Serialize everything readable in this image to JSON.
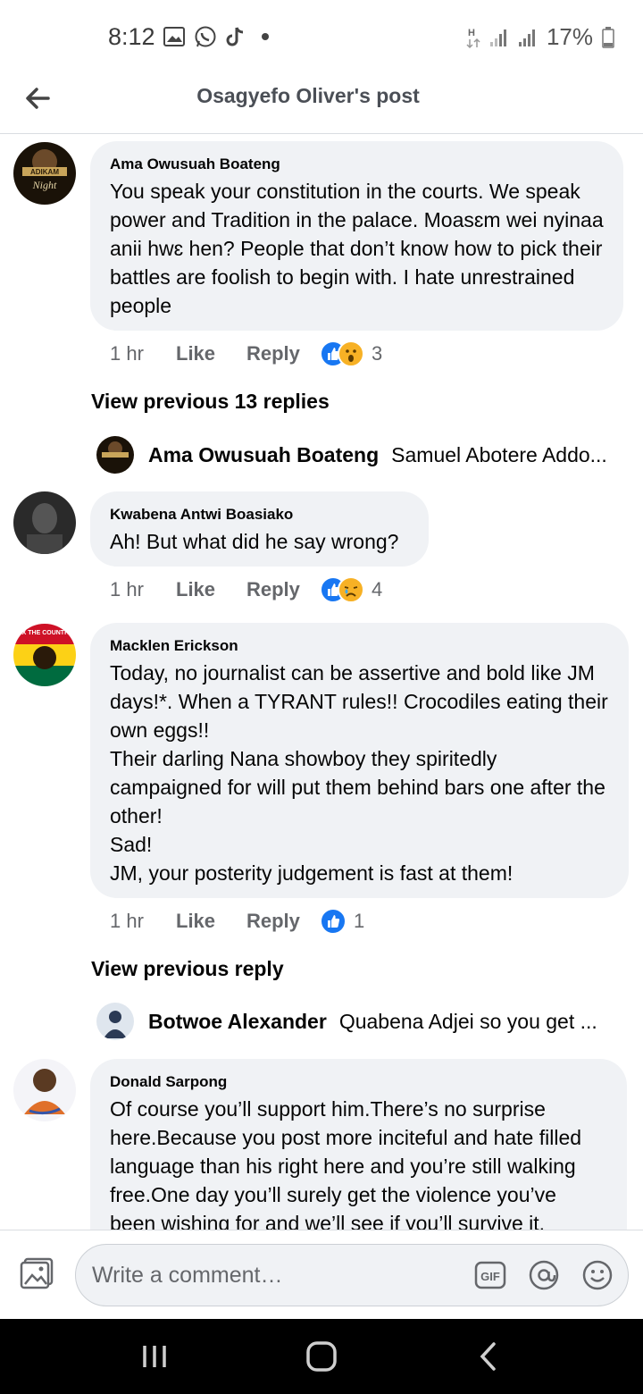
{
  "status_bar": {
    "time": "8:12",
    "battery": "17%",
    "network": "H"
  },
  "header": {
    "title": "Osagyefo Oliver's post"
  },
  "comments": [
    {
      "author": "Ama Owusuah Boateng",
      "text": "You speak your constitution in the courts. We speak power and Tradition in the palace. Moasɛm wei nyinaa anii hwɛ hen? People that don’t know how to pick their battles are foolish to begin with. I hate unrestrained people",
      "time": "1 hr",
      "like": "Like",
      "reply": "Reply",
      "reactions": [
        "like",
        "wow"
      ],
      "reaction_count": "3"
    },
    {
      "author": "Kwabena Antwi Boasiako",
      "text": "Ah! But what did he say wrong?",
      "time": "1 hr",
      "like": "Like",
      "reply": "Reply",
      "reactions": [
        "like",
        "sad"
      ],
      "reaction_count": "4"
    },
    {
      "author": "Macklen Erickson",
      "text": "Today, no journalist can be assertive and bold like JM days!*. When a TYRANT rules!! Crocodiles eating their own eggs!!\nTheir darling Nana showboy they spiritedly campaigned for will put them behind bars one after the other!\nSad!\nJM, your posterity judgement is fast at them!",
      "time": "1 hr",
      "like": "Like",
      "reply": "Reply",
      "reactions": [
        "like"
      ],
      "reaction_count": "1"
    },
    {
      "author": "Donald Sarpong",
      "text": "Of course you’ll support him.There’s no surprise here.Because you post more inciteful and hate filled language than his right here and you’re still walking free.One day you’ll surely get the violence you’ve been wishing for and we’ll see if you’ll survive it."
    }
  ],
  "view_previous_1": "View previous 13 replies",
  "collapsed_reply_1": {
    "author": "Ama Owusuah Boateng",
    "text": "Samuel Abotere Addo..."
  },
  "view_previous_2": "View previous reply",
  "collapsed_reply_2": {
    "author": "Botwoe Alexander",
    "text": "Quabena Adjei so you get ..."
  },
  "avatar_texts": {
    "fix_the_country": "FIX THE COUNTRY",
    "adikam": "ADIKAM",
    "night": "Night"
  },
  "composer": {
    "placeholder": "Write a comment…",
    "gif_label": "GIF"
  },
  "colors": {
    "accent": "#1877f2",
    "bubble": "#f0f2f5",
    "secondary_text": "#65676b"
  }
}
